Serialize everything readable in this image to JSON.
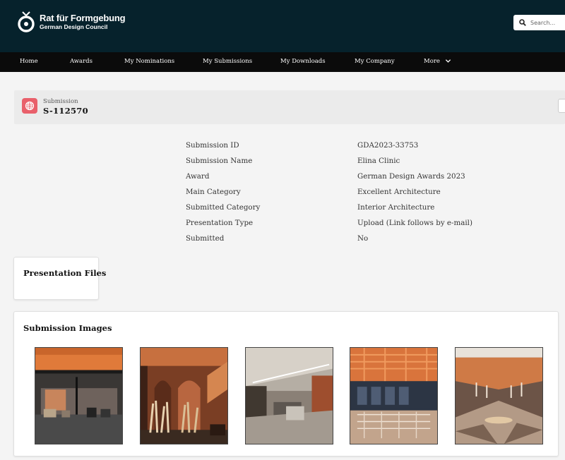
{
  "brand": {
    "name": "Rat für Formgebung",
    "subtitle": "German Design Council"
  },
  "search": {
    "placeholder": "Search..."
  },
  "nav": {
    "items": [
      {
        "label": "Home"
      },
      {
        "label": "Awards"
      },
      {
        "label": "My Nominations"
      },
      {
        "label": "My Submissions"
      },
      {
        "label": "My Downloads"
      },
      {
        "label": "My Company"
      },
      {
        "label": "More"
      }
    ]
  },
  "record": {
    "type_label": "Submission",
    "id": "S-112570"
  },
  "details": [
    {
      "label": "Submission ID",
      "value": "GDA2023-33753"
    },
    {
      "label": "Submission Name",
      "value": "Elina Clinic"
    },
    {
      "label": "Award",
      "value": "German Design Awards 2023"
    },
    {
      "label": "Main Category",
      "value": "Excellent Architecture"
    },
    {
      "label": "Submitted Category",
      "value": "Interior Architecture"
    },
    {
      "label": "Presentation Type",
      "value": "Upload (Link follows by e-mail)"
    },
    {
      "label": "Submitted",
      "value": "No"
    }
  ],
  "presentation_files": {
    "title": "Presentation Files"
  },
  "submission_images": {
    "title": "Submission Images",
    "count": 5
  },
  "colors": {
    "header_bg": "#06222c",
    "nav_bg": "#0b0b0b",
    "record_icon_bg": "#e9606b",
    "page_bg": "#f4f4f4"
  },
  "icons": {
    "logo": "council-logo-icon",
    "search": "search-icon",
    "more": "chevron-down-icon",
    "record": "globe-icon"
  }
}
